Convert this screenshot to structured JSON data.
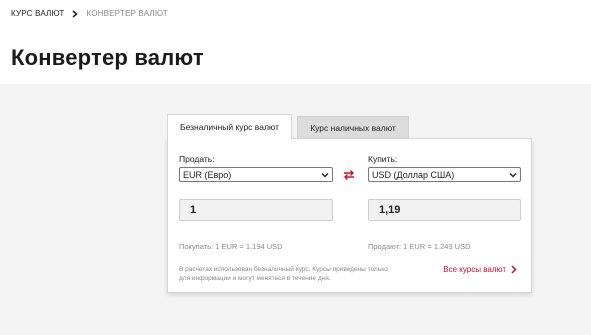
{
  "breadcrumb": {
    "home": "КУРС ВАЛЮТ",
    "current": "КОНВЕРТЕР ВАЛЮТ"
  },
  "page_title": "Конвертер валют",
  "tabs": [
    {
      "label": "Безналичный курс валют",
      "active": true
    },
    {
      "label": "Курс наличных валют",
      "active": false
    }
  ],
  "sell": {
    "label": "Продать:",
    "currency": "EUR (Евро)",
    "amount": "1",
    "rate": "Покупать: 1 EUR = 1.194 USD"
  },
  "buy": {
    "label": "Купить:",
    "currency": "USD (Доллар США)",
    "amount": "1,19",
    "rate": "Продают: 1 EUR = 1.243 USD"
  },
  "note": "В расчетах использован безналичный курс. Курсы приведены только для информации и могут меняться в течение дня.",
  "all_rates_link": "Все курсы валют",
  "colors": {
    "accent": "#c8102e",
    "background": "#f3f3f3"
  },
  "icons": {
    "breadcrumb_separator": "chevron-right-icon",
    "swap": "swap-arrows-icon",
    "select_arrow": "chevron-down-icon",
    "link_arrow": "chevron-right-icon"
  }
}
